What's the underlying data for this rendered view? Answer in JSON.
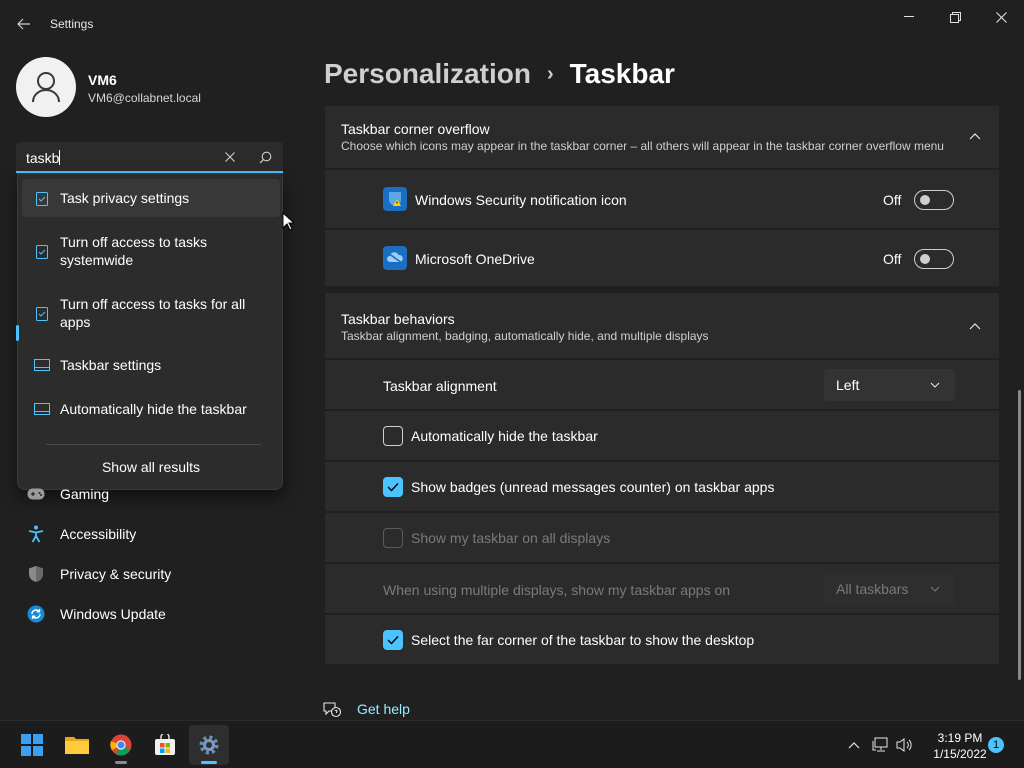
{
  "window": {
    "title": "Settings",
    "back_icon": "arrow-left-icon",
    "minimize_icon": "minimize-icon",
    "maximize_icon": "restore-icon",
    "close_icon": "close-icon"
  },
  "profile": {
    "name": "VM6",
    "email": "VM6@collabnet.local"
  },
  "search": {
    "value": "taskb",
    "clear_icon": "close-icon",
    "go_icon": "search-icon",
    "suggestions": [
      {
        "label": "Task privacy settings",
        "icon": "task-icon"
      },
      {
        "label": "Turn off access to tasks systemwide",
        "icon": "task-icon"
      },
      {
        "label": "Turn off access to tasks for all apps",
        "icon": "task-icon"
      },
      {
        "label": "Taskbar settings",
        "icon": "taskbar-icon"
      },
      {
        "label": "Automatically hide the taskbar",
        "icon": "taskbar-icon"
      }
    ],
    "show_all": "Show all results"
  },
  "nav": {
    "items": [
      {
        "label": "Gaming",
        "icon": "gaming-icon"
      },
      {
        "label": "Accessibility",
        "icon": "accessibility-icon"
      },
      {
        "label": "Privacy & security",
        "icon": "shield-icon"
      },
      {
        "label": "Windows Update",
        "icon": "update-icon"
      }
    ]
  },
  "header": {
    "parent": "Personalization",
    "separator": "›",
    "current": "Taskbar"
  },
  "corner_overflow": {
    "title": "Taskbar corner overflow",
    "description": "Choose which icons may appear in the taskbar corner – all others will appear in the taskbar corner overflow menu",
    "items": [
      {
        "label": "Windows Security notification icon",
        "status": "Off",
        "icon": "windows-security-icon"
      },
      {
        "label": "Microsoft OneDrive",
        "status": "Off",
        "icon": "onedrive-icon"
      }
    ]
  },
  "behaviors": {
    "title": "Taskbar behaviors",
    "description": "Taskbar alignment, badging, automatically hide, and multiple displays",
    "alignment_label": "Taskbar alignment",
    "alignment_value": "Left",
    "auto_hide": "Automatically hide the taskbar",
    "show_badges": "Show badges (unread messages counter) on taskbar apps",
    "all_displays": "Show my taskbar on all displays",
    "multi_display_label": "When using multiple displays, show my taskbar apps on",
    "multi_display_value": "All taskbars",
    "far_corner": "Select the far corner of the taskbar to show the desktop"
  },
  "help": {
    "label": "Get help"
  },
  "taskbar": {
    "apps": [
      "start-icon",
      "file-explorer-icon",
      "chrome-icon",
      "store-icon",
      "settings-icon"
    ],
    "time": "3:19 PM",
    "date": "1/15/2022",
    "notification_count": "1"
  },
  "colors": {
    "accent": "#4cc2ff",
    "background": "#202020",
    "card": "#2b2b2b"
  }
}
